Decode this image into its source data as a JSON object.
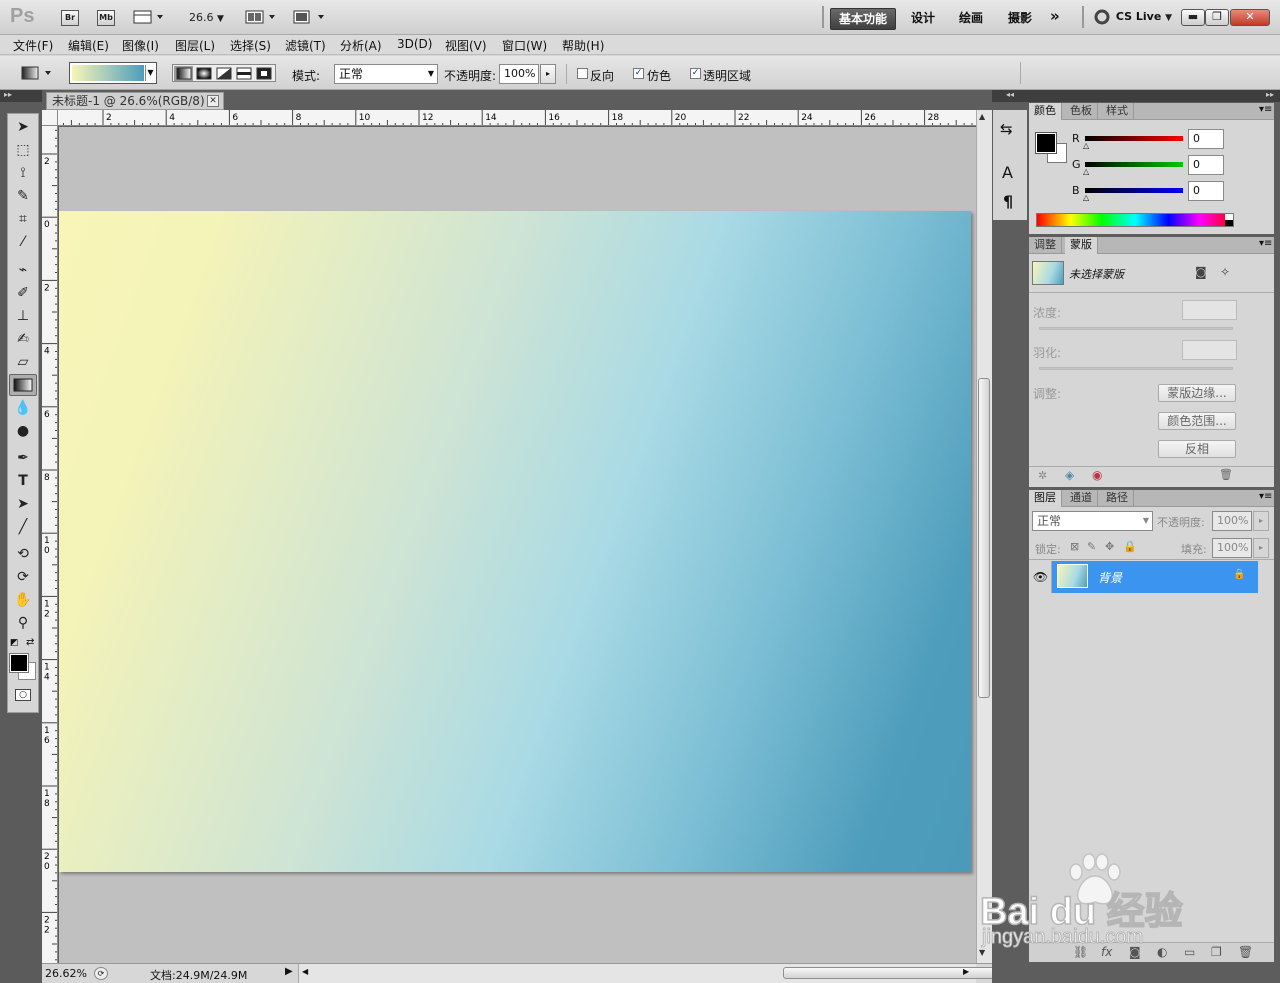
{
  "appbar": {
    "logo": "Ps",
    "br_label": "Br",
    "mb_label": "Mb",
    "zoom": "26.6",
    "workspaces": [
      "基本功能",
      "设计",
      "绘画",
      "摄影"
    ],
    "more": "»",
    "cs_live": "CS Live"
  },
  "menubar": {
    "items": [
      "文件(F)",
      "编辑(E)",
      "图像(I)",
      "图层(L)",
      "选择(S)",
      "滤镜(T)",
      "分析(A)",
      "3D(D)",
      "视图(V)",
      "窗口(W)",
      "帮助(H)"
    ]
  },
  "options": {
    "mode_label": "模式:",
    "mode_value": "正常",
    "opacity_label": "不透明度:",
    "opacity_value": "100%",
    "reverse_label": "反向",
    "reverse_checked": false,
    "dither_label": "仿色",
    "dither_checked": true,
    "transparency_label": "透明区域",
    "transparency_checked": true,
    "gradient_start": "#f8f5b7",
    "gradient_end": "#4e9dbc"
  },
  "document": {
    "tab_title": "未标题-1 @ 26.6%(RGB/8) *",
    "ruler_top": [
      "2",
      "4",
      "6",
      "8",
      "10",
      "12",
      "14",
      "16",
      "18",
      "20",
      "22",
      "24",
      "26",
      "28"
    ],
    "ruler_left": [
      "2",
      "0",
      "2",
      "4",
      "6",
      "8",
      "10",
      "12",
      "14",
      "16",
      "18",
      "20",
      "22"
    ],
    "zoom_status": "26.62%",
    "doc_info": "文档:24.9M/24.9M"
  },
  "color_panel": {
    "tabs": [
      "颜色",
      "色板",
      "样式"
    ],
    "channels": [
      {
        "label": "R",
        "value": "0"
      },
      {
        "label": "G",
        "value": "0"
      },
      {
        "label": "B",
        "value": "0"
      }
    ]
  },
  "masks_panel": {
    "tabs": [
      "调整",
      "蒙版"
    ],
    "no_mask": "未选择蒙版",
    "density_label": "浓度:",
    "feather_label": "羽化:",
    "refine_label": "调整:",
    "mask_edge_button": "蒙版边缘...",
    "color_range_button": "颜色范围...",
    "invert_button": "反相"
  },
  "layers_panel": {
    "tabs": [
      "图层",
      "通道",
      "路径"
    ],
    "blend_mode": "正常",
    "opacity_label": "不透明度:",
    "opacity_value": "100%",
    "lock_label": "锁定:",
    "fill_label": "填充:",
    "fill_value": "100%",
    "layers": [
      {
        "name": "背景",
        "locked": true,
        "visible": true
      }
    ]
  },
  "watermark": {
    "brand": "Bai du 经验",
    "url": "jingyan.baidu.com"
  }
}
